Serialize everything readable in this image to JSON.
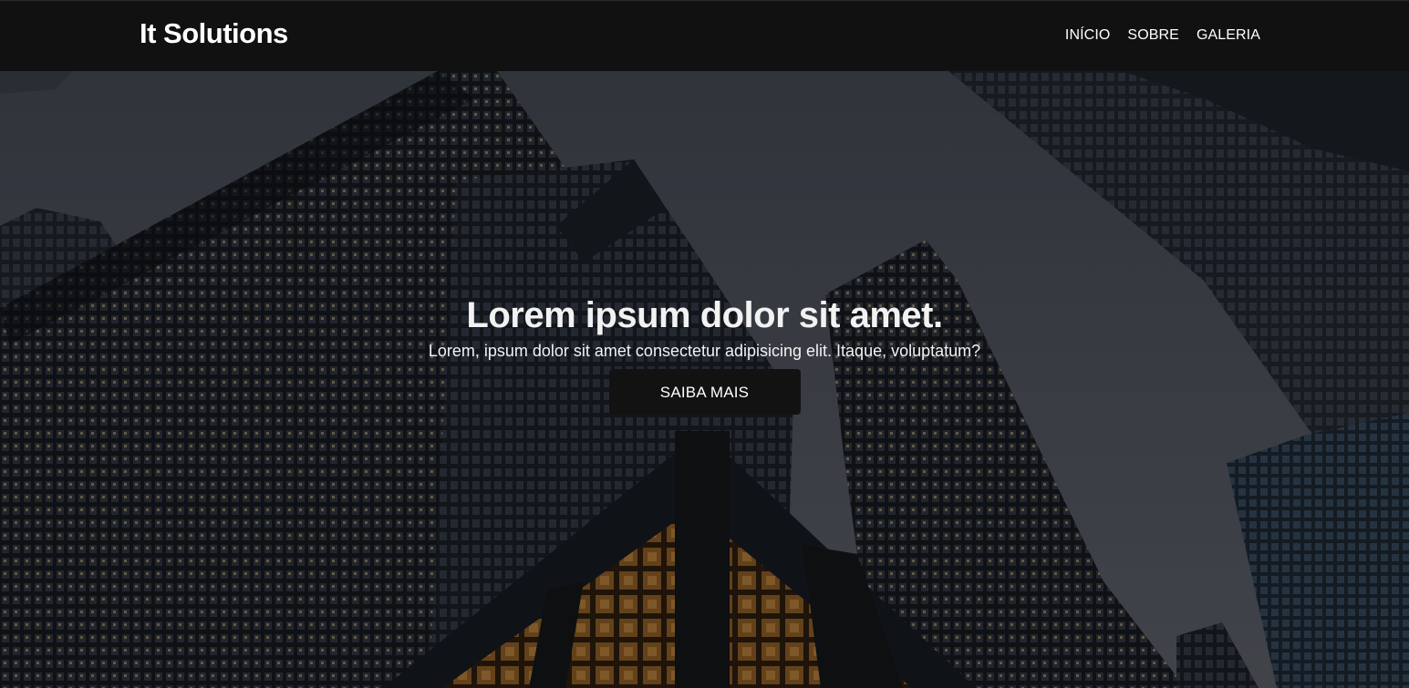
{
  "header": {
    "brand": "It Solutions",
    "nav": [
      {
        "label": "INÍCIO"
      },
      {
        "label": "SOBRE"
      },
      {
        "label": "GALERIA"
      }
    ]
  },
  "hero": {
    "title": "Lorem ipsum dolor sit amet.",
    "subtitle": "Lorem, ipsum dolor sit amet consectetur adipisicing elit. Itaque, voluptatum?",
    "button_label": "SAIBA MAIS",
    "background_image": "low-angle-skyscrapers-photo"
  },
  "colors": {
    "header_bg": "#111111",
    "button_bg": "#121212",
    "text": "#ffffff"
  }
}
